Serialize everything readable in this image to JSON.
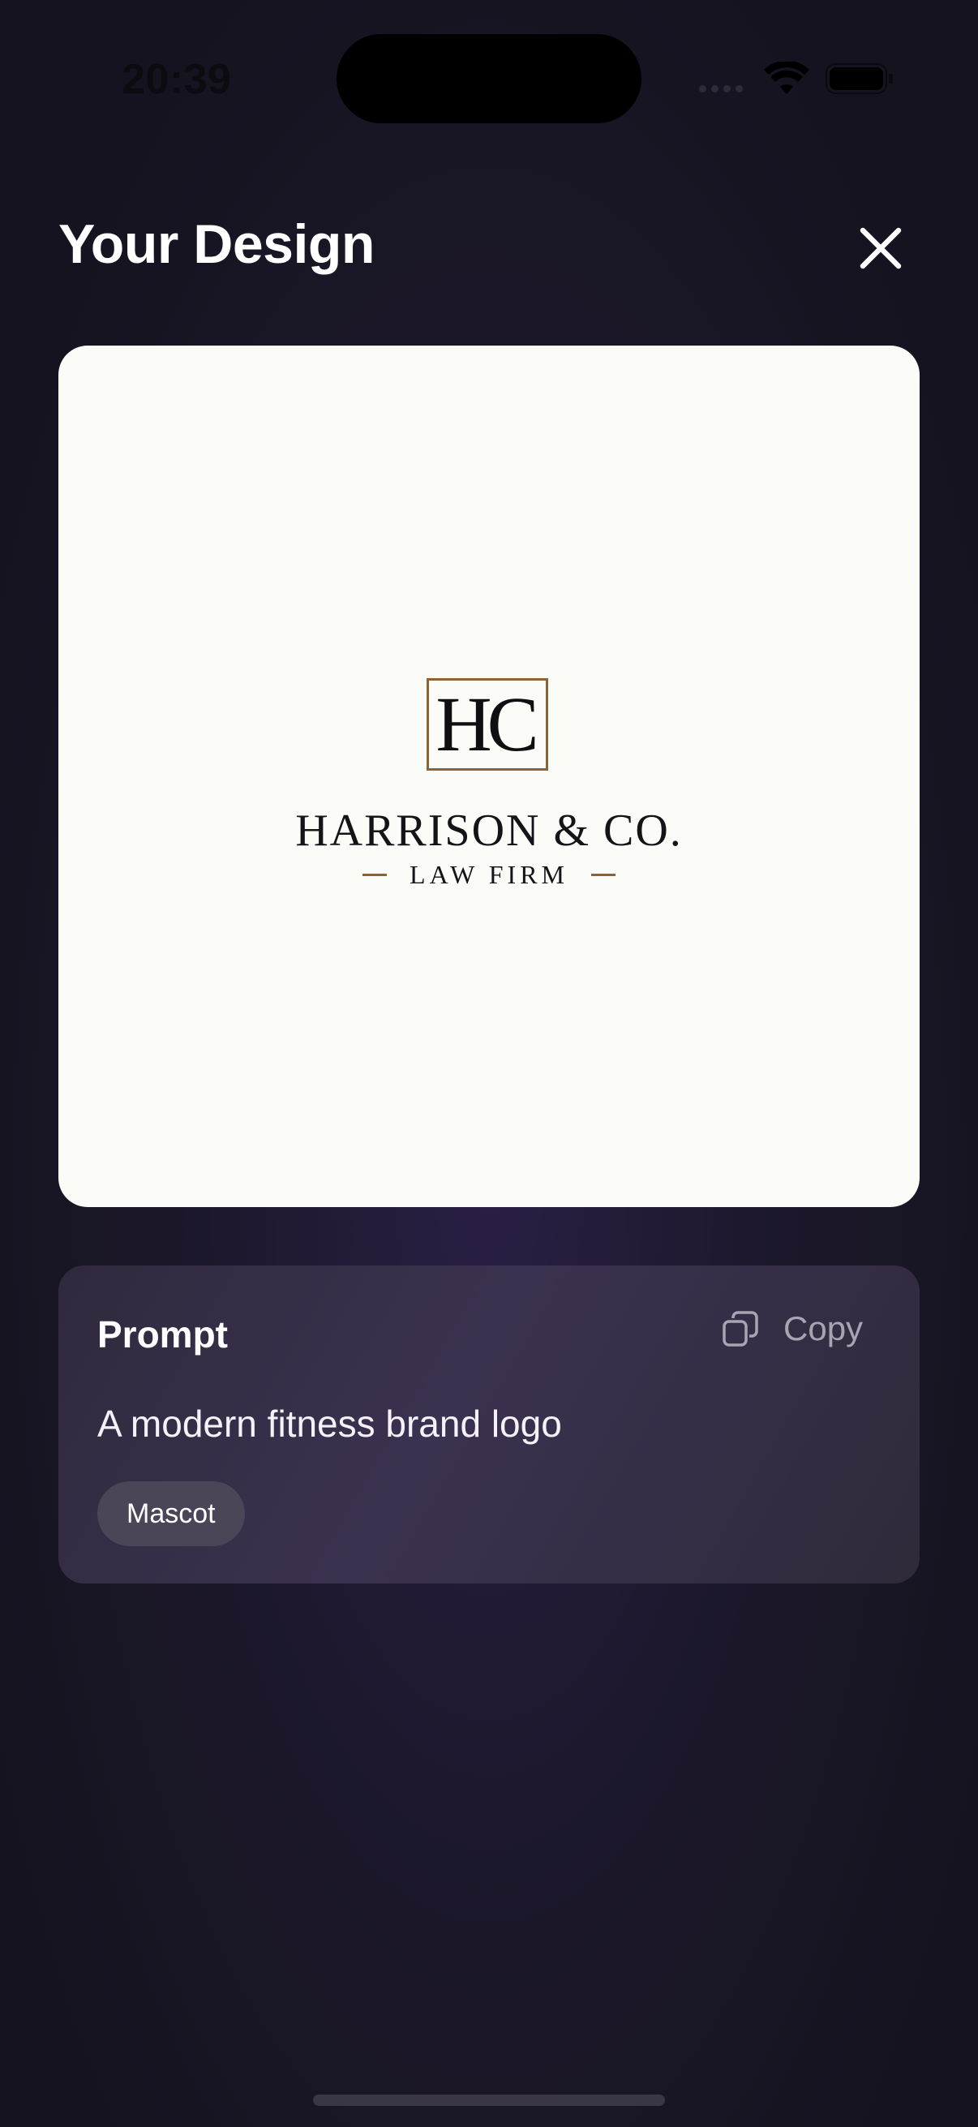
{
  "status_bar": {
    "time": "20:39",
    "icons": [
      "cellular-icon",
      "wifi-icon",
      "battery-icon"
    ]
  },
  "header": {
    "title": "Your Design",
    "close_icon": "close-icon"
  },
  "design": {
    "logo_monogram": "HC",
    "logo_name": "HARRISON & CO.",
    "logo_subtitle": "LAW FIRM",
    "accent_color": "#8a6438"
  },
  "prompt_card": {
    "label": "Prompt",
    "copy_label": "Copy",
    "copy_icon": "copy-icon",
    "prompt_text": "A modern fitness brand logo",
    "tag": "Mascot"
  },
  "colors": {
    "background": "#1b1729",
    "card_background": "#fbfbf8",
    "prompt_card_background": "#352e45",
    "tag_background": "#4b4558",
    "muted_text": "#a8a4b2"
  }
}
